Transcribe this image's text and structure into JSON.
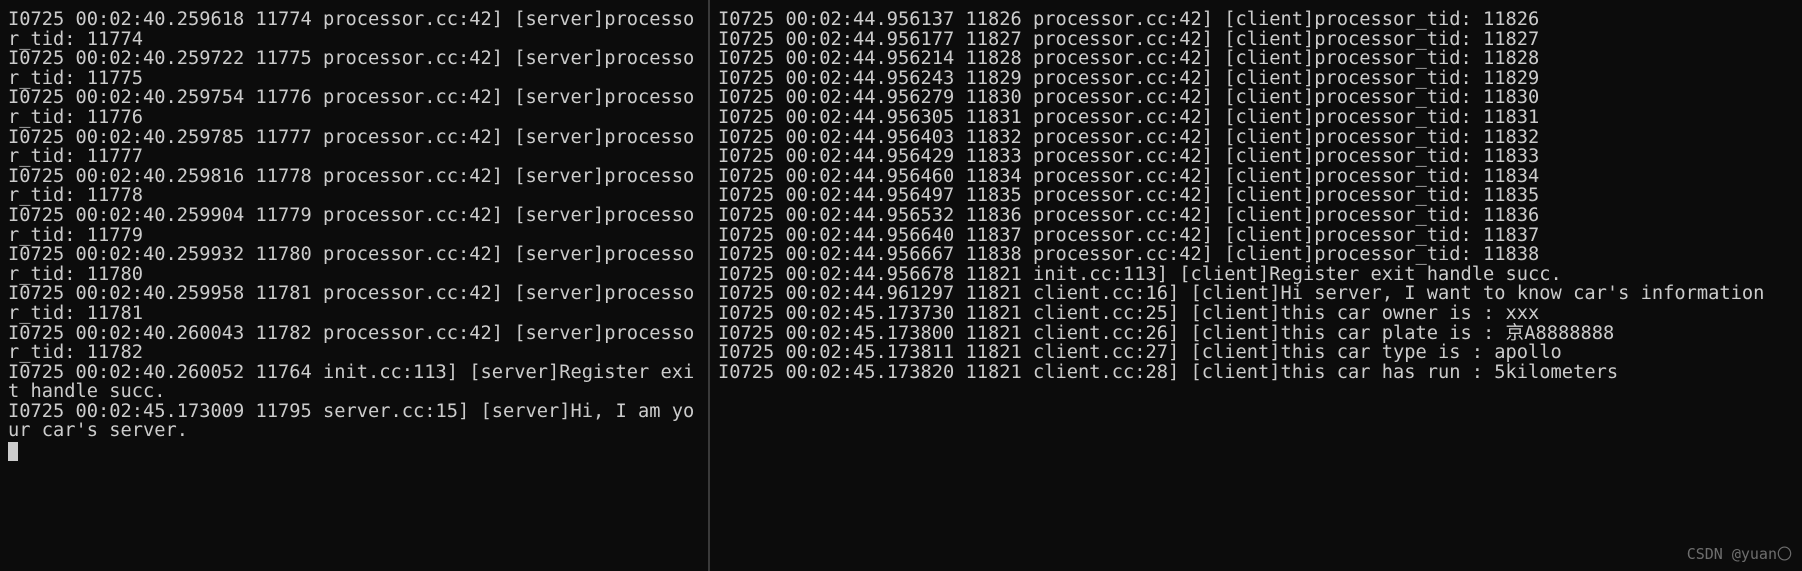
{
  "left": {
    "lines": [
      "I0725 00:02:40.259618 11774 processor.cc:42] [server]processor_tid: 11774",
      "I0725 00:02:40.259722 11775 processor.cc:42] [server]processor_tid: 11775",
      "I0725 00:02:40.259754 11776 processor.cc:42] [server]processor_tid: 11776",
      "I0725 00:02:40.259785 11777 processor.cc:42] [server]processor_tid: 11777",
      "I0725 00:02:40.259816 11778 processor.cc:42] [server]processor_tid: 11778",
      "I0725 00:02:40.259904 11779 processor.cc:42] [server]processor_tid: 11779",
      "I0725 00:02:40.259932 11780 processor.cc:42] [server]processor_tid: 11780",
      "I0725 00:02:40.259958 11781 processor.cc:42] [server]processor_tid: 11781",
      "I0725 00:02:40.260043 11782 processor.cc:42] [server]processor_tid: 11782",
      "I0725 00:02:40.260052 11764 init.cc:113] [server]Register exit handle succ.",
      "I0725 00:02:45.173009 11795 server.cc:15] [server]Hi, I am your car's server."
    ]
  },
  "right": {
    "lines": [
      "I0725 00:02:44.956137 11826 processor.cc:42] [client]processor_tid: 11826",
      "I0725 00:02:44.956177 11827 processor.cc:42] [client]processor_tid: 11827",
      "I0725 00:02:44.956214 11828 processor.cc:42] [client]processor_tid: 11828",
      "I0725 00:02:44.956243 11829 processor.cc:42] [client]processor_tid: 11829",
      "I0725 00:02:44.956279 11830 processor.cc:42] [client]processor_tid: 11830",
      "I0725 00:02:44.956305 11831 processor.cc:42] [client]processor_tid: 11831",
      "I0725 00:02:44.956403 11832 processor.cc:42] [client]processor_tid: 11832",
      "I0725 00:02:44.956429 11833 processor.cc:42] [client]processor_tid: 11833",
      "I0725 00:02:44.956460 11834 processor.cc:42] [client]processor_tid: 11834",
      "I0725 00:02:44.956497 11835 processor.cc:42] [client]processor_tid: 11835",
      "I0725 00:02:44.956532 11836 processor.cc:42] [client]processor_tid: 11836",
      "I0725 00:02:44.956640 11837 processor.cc:42] [client]processor_tid: 11837",
      "I0725 00:02:44.956667 11838 processor.cc:42] [client]processor_tid: 11838",
      "I0725 00:02:44.956678 11821 init.cc:113] [client]Register exit handle succ.",
      "I0725 00:02:44.961297 11821 client.cc:16] [client]Hi server, I want to know car's information",
      "I0725 00:02:45.173730 11821 client.cc:25] [client]this car owner is : xxx",
      "I0725 00:02:45.173800 11821 client.cc:26] [client]this car plate is : 京A8888888",
      "I0725 00:02:45.173811 11821 client.cc:27] [client]this car type is : apollo",
      "I0725 00:02:45.173820 11821 client.cc:28] [client]this car has run : 5kilometers"
    ]
  },
  "watermark": "CSDN @yuan〇"
}
